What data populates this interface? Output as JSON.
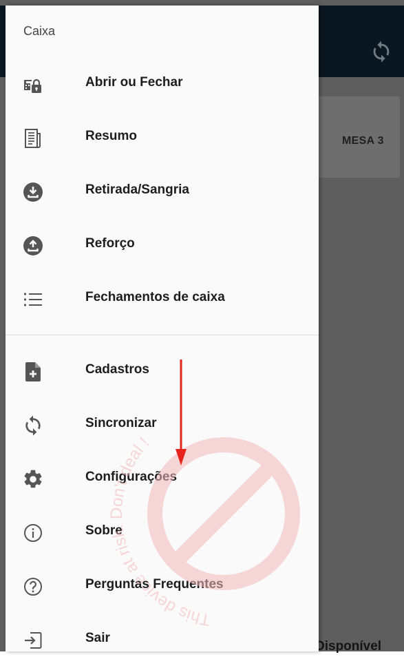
{
  "background": {
    "card_label": "MESA 3",
    "bottom_text": "Disponível"
  },
  "drawer": {
    "section_title": "Caixa",
    "items": [
      {
        "label": "Abrir ou Fechar",
        "icon": "register-lock-icon"
      },
      {
        "label": "Resumo",
        "icon": "document-icon"
      },
      {
        "label": "Retirada/Sangria",
        "icon": "download-circle-icon"
      },
      {
        "label": "Reforço",
        "icon": "upload-circle-icon"
      },
      {
        "label": "Fechamentos de caixa",
        "icon": "list-icon"
      },
      {
        "label": "Cadastros",
        "icon": "add-file-icon"
      },
      {
        "label": "Sincronizar",
        "icon": "sync-icon"
      },
      {
        "label": "Configurações",
        "icon": "gear-icon"
      },
      {
        "label": "Sobre",
        "icon": "info-icon"
      },
      {
        "label": "Perguntas Frequentes",
        "icon": "help-circle-icon"
      },
      {
        "label": "Sair",
        "icon": "exit-icon"
      }
    ]
  },
  "watermark": {
    "text": "This device at risk. Don't deal !"
  },
  "colors": {
    "appbar": "#0a1620",
    "drawer_bg": "#fafafa",
    "icon": "#555555",
    "annotation_arrow": "#e8231c",
    "watermark": "#f2b8b8"
  }
}
